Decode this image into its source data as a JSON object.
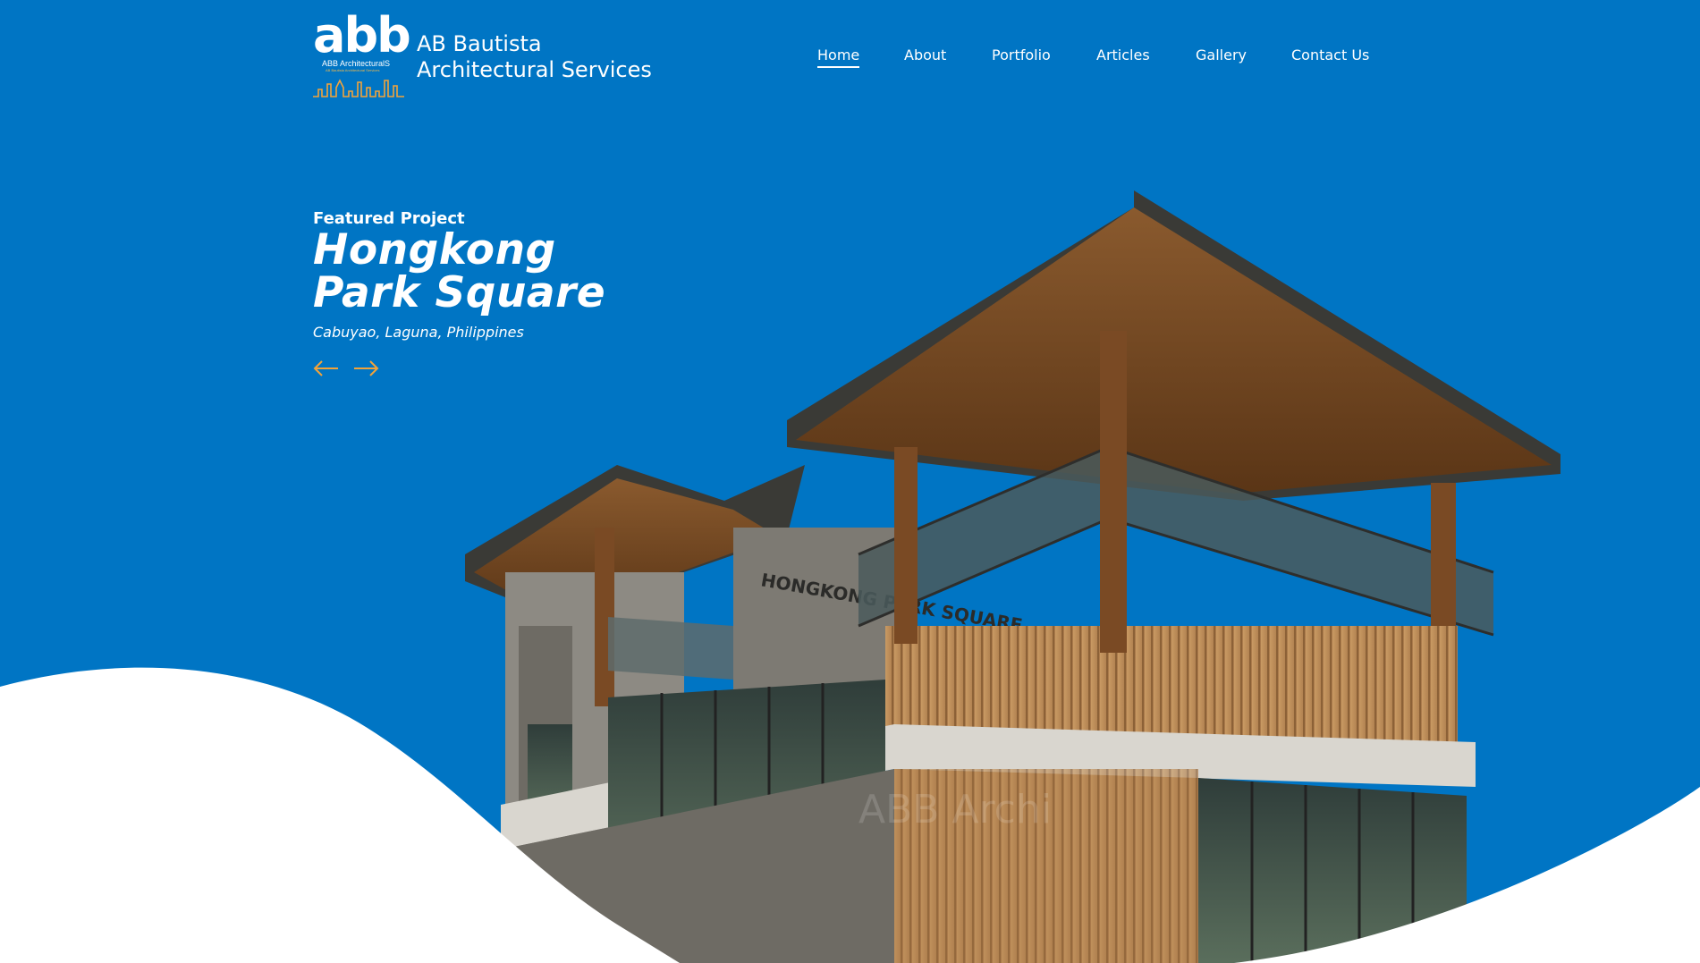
{
  "brand": {
    "logo_mark": "abb",
    "logo_subtitle": "ABB ArchitecturalS",
    "logo_tagline": "AB Bautista Architectural Services",
    "name_line1": "AB Bautista",
    "name_line2": "Architectural Services"
  },
  "nav": {
    "items": [
      {
        "label": "Home",
        "active": true
      },
      {
        "label": "About",
        "active": false
      },
      {
        "label": "Portfolio",
        "active": false
      },
      {
        "label": "Articles",
        "active": false
      },
      {
        "label": "Gallery",
        "active": false
      },
      {
        "label": "Contact Us",
        "active": false
      }
    ]
  },
  "hero": {
    "kicker": "Featured Project",
    "title_line1": "Hongkong",
    "title_line2": "Park Square",
    "location": "Cabuyao, Laguna, Philippines",
    "prev_icon": "arrow-left-icon",
    "next_icon": "arrow-right-icon",
    "building_sign": "HONGKONG PARK SQUARE",
    "watermark": "ABB Archi"
  },
  "colors": {
    "background": "#0075c4",
    "accent": "#f2a33a",
    "text": "#ffffff",
    "wave": "#ffffff"
  }
}
